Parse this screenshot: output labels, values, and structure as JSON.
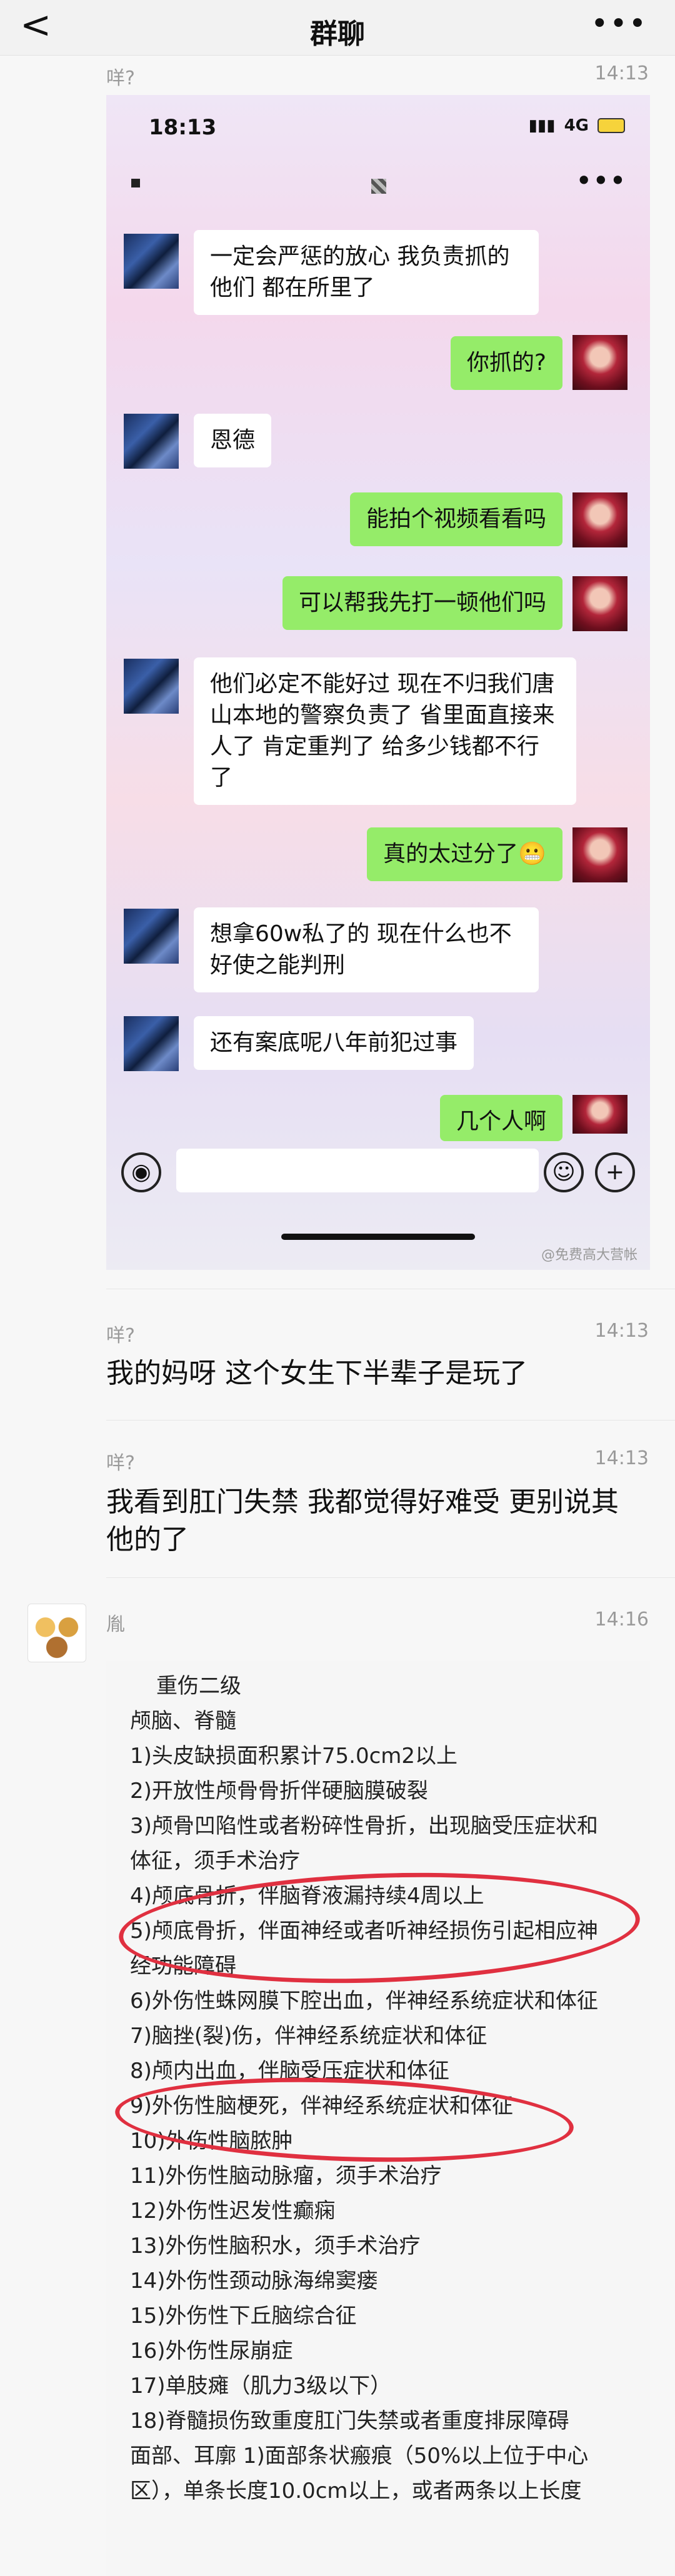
{
  "nav": {
    "back": "<",
    "title": "群聊",
    "more": "•••"
  },
  "messages": [
    {
      "sender": "咩?",
      "time": "14:13"
    },
    {
      "sender": "咩?",
      "time": "14:13",
      "text": "我的妈呀 这个女生下半辈子是玩了"
    },
    {
      "sender": "咩?",
      "time": "14:13",
      "text": "我看到肛门失禁 我都觉得好难受 更别说其他的了"
    },
    {
      "sender": "胤",
      "time": "14:16"
    }
  ],
  "screenshot": {
    "status_time": "18:13",
    "network": "4G",
    "chat": [
      {
        "side": "left",
        "text": "一定会严惩的放心 我负责抓的他们 都在所里了"
      },
      {
        "side": "right",
        "text": "你抓的?"
      },
      {
        "side": "left",
        "text": "恩德"
      },
      {
        "side": "right",
        "text": "能拍个视频看看吗"
      },
      {
        "side": "right",
        "text": "可以帮我先打一顿他们吗"
      },
      {
        "side": "left",
        "text": "他们必定不能好过 现在不归我们唐山本地的警察负责了 省里面直接来人了 肯定重判了 给多少钱都不行了"
      },
      {
        "side": "right",
        "text": "真的太过分了😬"
      },
      {
        "side": "left",
        "text": "想拿60w私了的 现在什么也不好使之能判刑"
      },
      {
        "side": "left",
        "text": "还有案底呢八年前犯过事"
      },
      {
        "side": "right",
        "text": "几个人啊"
      }
    ],
    "watermark": "@免费高大营帐"
  },
  "injury_list": {
    "lines": [
      "重伤二级",
      "颅脑、脊髓",
      "1)头皮缺损面积累计75.0cm2以上",
      "2)开放性颅骨骨折伴硬脑膜破裂",
      "3)颅骨凹陷性或者粉碎性骨折，出现脑受压症状和",
      "体征，须手术治疗",
      "4)颅底骨折，伴脑脊液漏持续4周以上",
      "5)颅底骨折，伴面神经或者听神经损伤引起相应神",
      "经功能障碍",
      "6)外伤性蛛网膜下腔出血，伴神经系统症状和体征",
      "7)脑挫(裂)伤，伴神经系统症状和体征",
      "8)颅内出血，伴脑受压症状和体征",
      "9)外伤性脑梗死，伴神经系统症状和体征",
      "10)外伤性脑脓肿",
      "11)外伤性脑动脉瘤，须手术治疗",
      "12)外伤性迟发性癫痫",
      "13)外伤性脑积水，须手术治疗",
      "14)外伤性颈动脉海绵窦瘘",
      "15)外伤性下丘脑综合征",
      "16)外伤性尿崩症",
      "17)单肢瘫（肌力3级以下）",
      "18)脊髓损伤致重度肛门失禁或者重度排尿障碍",
      "面部、耳廓 1)面部条状瘢痕（50%以上位于中心",
      "区），单条长度10.0cm以上，或者两条以上长度"
    ],
    "highlight_color": "#e03040"
  }
}
